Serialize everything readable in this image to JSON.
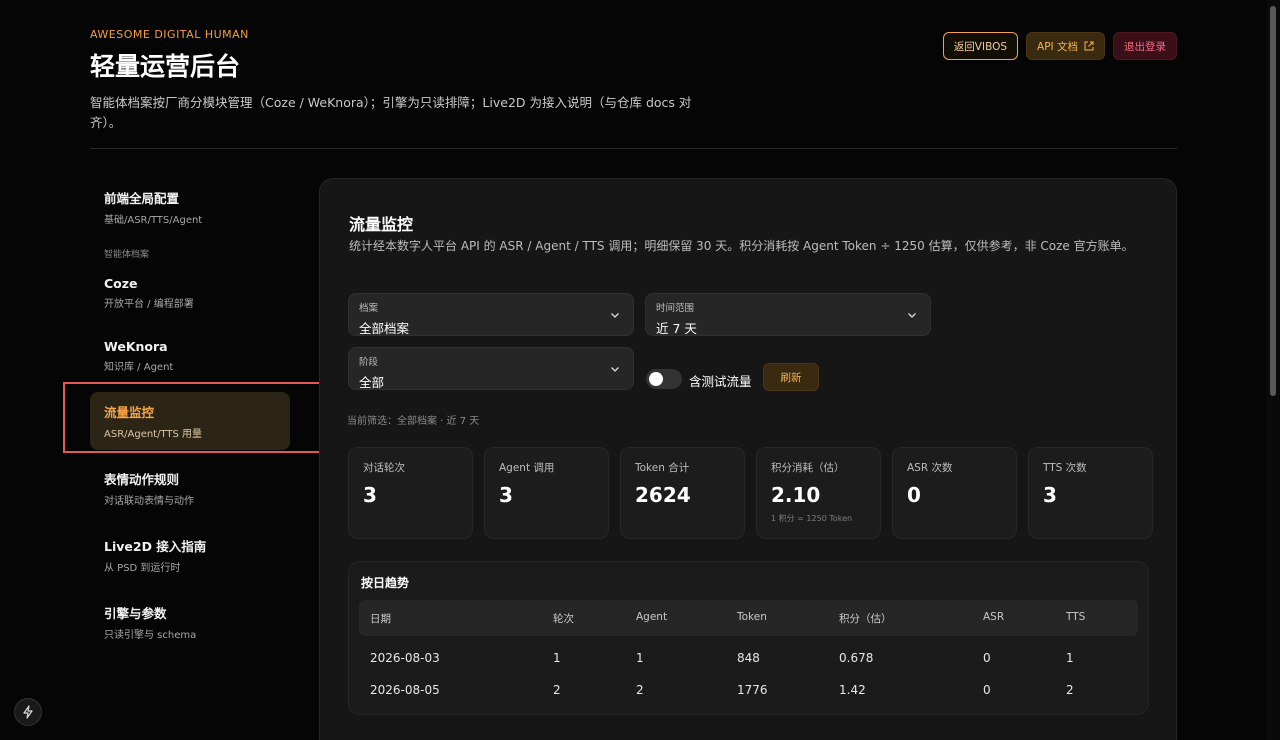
{
  "header": {
    "eyebrow": "AWESOME DIGITAL HUMAN",
    "title": "轻量运营后台",
    "subtitle": "智能体档案按厂商分模块管理（Coze / WeKnora）；引擎为只读排障；Live2D 为接入说明（与仓库 docs 对齐）。",
    "buttons": {
      "back": "返回VIBOS",
      "api": "API 文档",
      "logout": "退出登录"
    }
  },
  "sidebar": {
    "items": [
      {
        "title": "前端全局配置",
        "sub": "基础/ASR/TTS/Agent"
      },
      {
        "group": "智能体档案"
      },
      {
        "title": "Coze",
        "sub": "开放平台 / 编程部署"
      },
      {
        "title": "WeKnora",
        "sub": "知识库 / Agent"
      },
      {
        "title": "流量监控",
        "sub": "ASR/Agent/TTS 用量",
        "active": true
      },
      {
        "title": "表情动作规则",
        "sub": "对话联动表情与动作"
      },
      {
        "title": "Live2D 接入指南",
        "sub": "从 PSD 到运行时"
      },
      {
        "title": "引擎与参数",
        "sub": "只读引擎与 schema"
      }
    ]
  },
  "panel": {
    "title": "流量监控",
    "desc": "统计经本数字人平台 API 的 ASR / Agent / TTS 调用；明细保留 30 天。积分消耗按 Agent Token ÷ 1250 估算，仅供参考，非 Coze 官方账单。",
    "filters": {
      "archive": {
        "label": "档案",
        "value": "全部档案"
      },
      "range": {
        "label": "时间范围",
        "value": "近 7 天"
      },
      "stage": {
        "label": "阶段",
        "value": "全部"
      },
      "toggle_label": "含测试流量",
      "toggle_on": false,
      "refresh": "刷新",
      "note": "当前筛选：全部档案 · 近 7 天"
    },
    "stats": [
      {
        "label": "对话轮次",
        "value": "3"
      },
      {
        "label": "Agent 调用",
        "value": "3"
      },
      {
        "label": "Token 合计",
        "value": "2624"
      },
      {
        "label": "积分消耗（估）",
        "value": "2.10",
        "note": "1 积分 = 1250 Token"
      },
      {
        "label": "ASR 次数",
        "value": "0"
      },
      {
        "label": "TTS 次数",
        "value": "3"
      }
    ],
    "trend": {
      "title": "按日趋势",
      "columns": [
        "日期",
        "轮次",
        "Agent",
        "Token",
        "积分（估）",
        "ASR",
        "TTS"
      ],
      "rows": [
        [
          "2026-08-03",
          "1",
          "1",
          "848",
          "0.678",
          "0",
          "1"
        ],
        [
          "2026-08-05",
          "2",
          "2",
          "1776",
          "1.42",
          "0",
          "2"
        ]
      ]
    }
  },
  "colors": {
    "accent": "#f4a545",
    "danger": "#f26d84",
    "highlight_box": "#e05a5a"
  },
  "icons": {
    "external": "external-link-icon",
    "chevron": "chevron-down-icon",
    "fab": "lightning-icon"
  }
}
